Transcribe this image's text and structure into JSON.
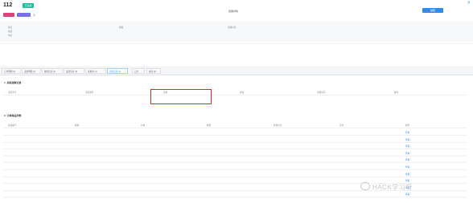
{
  "header": {
    "title": "112",
    "status_badge": "已完成",
    "tag_gray": "无",
    "action_button": "编辑"
  },
  "info": {
    "rows": [
      {
        "label": "姓名",
        "value": ""
      },
      {
        "label": "电话",
        "value": ""
      },
      {
        "label": "地址",
        "value": ""
      }
    ],
    "middle_label": "邮箱",
    "right_label": "创建时间"
  },
  "middle_link": "查看详情",
  "tabs": [
    {
      "label": "订单明细 (1)"
    },
    {
      "label": "退款明细 (1)"
    },
    {
      "label": "物流信息 (1)"
    },
    {
      "label": "发票信息 (0)"
    },
    {
      "label": "优惠券 (1)"
    },
    {
      "label": "支付记录 (1)"
    },
    {
      "label": "日志"
    },
    {
      "label": "备注 (0)"
    }
  ],
  "section1": {
    "title": "1. 关联退款记录",
    "more": "",
    "columns": [
      "退款单号",
      "退款类型",
      "金额",
      "状态",
      "创建时间",
      "操作"
    ],
    "row": [
      "",
      "",
      "",
      "",
      "",
      ""
    ]
  },
  "section2": {
    "title": "2. 订单商品列表",
    "more": "",
    "columns": [
      "商品编号",
      "规格",
      "价格",
      "数量",
      "优惠信息",
      "实付",
      "操作"
    ],
    "rows": [
      {
        "code": "",
        "spec": "",
        "price": "",
        "qty": "",
        "disc": "",
        "paid": "",
        "op": "查看"
      },
      {
        "code": "",
        "spec": "",
        "price": "",
        "qty": "",
        "disc": "",
        "paid": "",
        "op": "查看"
      },
      {
        "code": "",
        "spec": "",
        "price": "",
        "qty": "",
        "disc": "",
        "paid": "",
        "op": "查看"
      },
      {
        "code": "",
        "spec": "",
        "price": "",
        "qty": "",
        "disc": "",
        "paid": "",
        "op": "查看"
      },
      {
        "code": "",
        "spec": "",
        "price": "",
        "qty": "",
        "disc": "",
        "paid": "",
        "op": "查看"
      },
      {
        "code": "",
        "spec": "",
        "price": "",
        "qty": "",
        "disc": "",
        "paid": "",
        "op": "查看"
      },
      {
        "code": "",
        "spec": "",
        "price": "",
        "qty": "",
        "disc": "",
        "paid": "",
        "op": "查看"
      },
      {
        "code": "",
        "spec": "",
        "price": "",
        "qty": "",
        "disc": "",
        "paid": "",
        "op": "查看"
      },
      {
        "code": "",
        "spec": "",
        "price": "",
        "qty": "",
        "disc": "",
        "paid": "",
        "op": "查看"
      },
      {
        "code": "",
        "spec": "",
        "price": "",
        "qty": "",
        "disc": "",
        "paid": "",
        "op": "查看"
      }
    ]
  },
  "watermark": "HACK学习呀",
  "colors": {
    "accent": "#2d8cf0",
    "badge": "#19be9b",
    "tag_pink": "#d9457a",
    "tag_purple": "#7b6fe6",
    "highlight": "#e0271f"
  }
}
